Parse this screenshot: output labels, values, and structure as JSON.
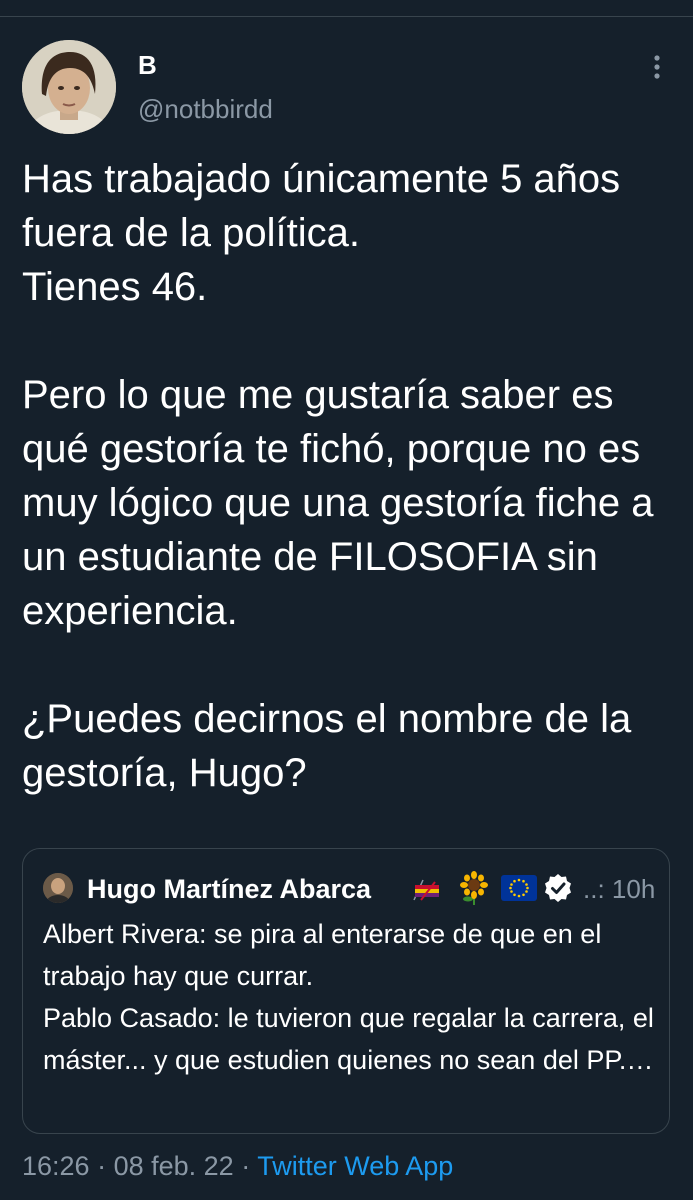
{
  "author": {
    "display_name": "B",
    "handle": "@notbbirdd"
  },
  "tweet": {
    "text": "Has trabajado únicamente 5 años fuera de la política.\nTienes 46.\n\nPero lo que me gustaría saber es qué gestoría te fichó, porque no es muy lógico que una gestoría fiche a un estudiante de FILOSOFIA sin experiencia.\n\n¿Puedes decirnos el nombre de la gestoría, Hugo?",
    "time": "16:26",
    "separator_1": " · ",
    "date": "08 feb. 22",
    "separator_2": " · ",
    "source": "Twitter Web App"
  },
  "quoted_tweet": {
    "display_name": "Hugo Martínez Abarca",
    "time": "..: 10h",
    "text": "Albert Rivera: se pira al enterarse de que en el trabajo hay que currar.\nPablo Casado: le tuvieron que regalar la carrera, el máster... y que estudien quienes no sean del PP.…"
  },
  "icons": {
    "more": "more-vertical-icon",
    "flag": "tricolor-flag-icon",
    "sunflower": "sunflower-icon",
    "eu": "eu-flag-icon",
    "verified": "verified-badge-icon"
  },
  "colors": {
    "background": "#15202b",
    "text": "#ffffff",
    "secondary_text": "#8b98a5",
    "link": "#1d9bf0",
    "border": "#38444d"
  }
}
